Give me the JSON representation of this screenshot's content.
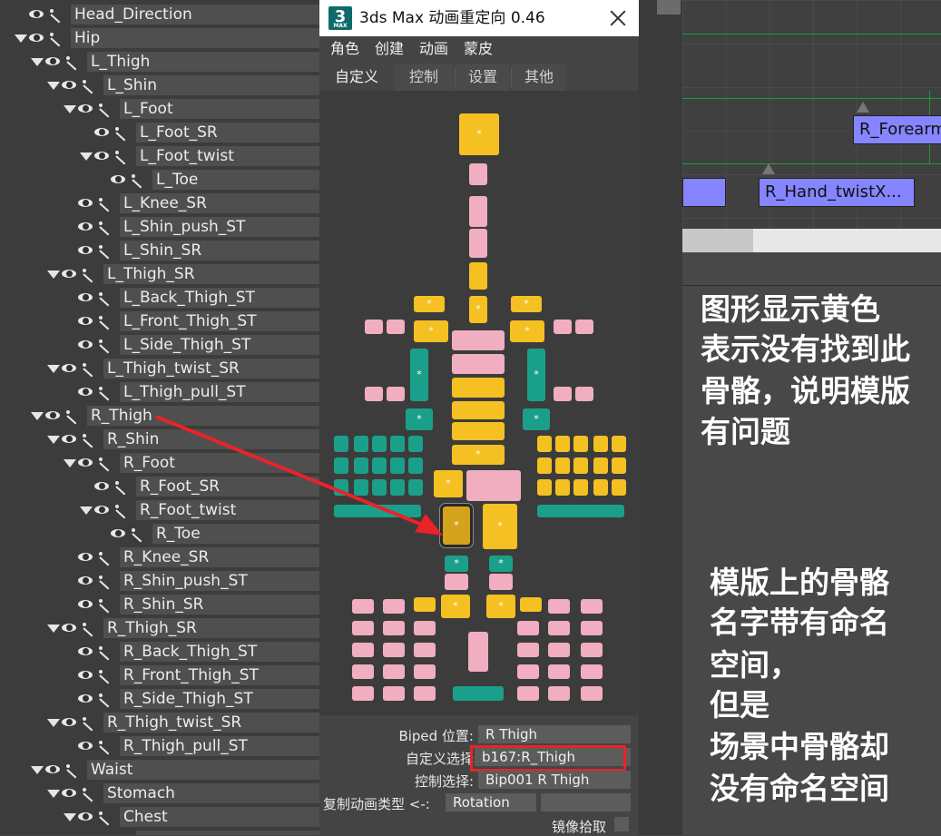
{
  "tree": {
    "rows": [
      {
        "label": "Head_Direction",
        "arrow": false
      },
      {
        "label": "Hip",
        "arrow": true
      },
      {
        "label": "L_Thigh",
        "arrow": true
      },
      {
        "label": "L_Shin",
        "arrow": true
      },
      {
        "label": "L_Foot",
        "arrow": true
      },
      {
        "label": "L_Foot_SR",
        "arrow": false
      },
      {
        "label": "L_Foot_twist",
        "arrow": true
      },
      {
        "label": "L_Toe",
        "arrow": false
      },
      {
        "label": "L_Knee_SR",
        "arrow": false
      },
      {
        "label": "L_Shin_push_ST",
        "arrow": false
      },
      {
        "label": "L_Shin_SR",
        "arrow": false
      },
      {
        "label": "L_Thigh_SR",
        "arrow": true
      },
      {
        "label": "L_Back_Thigh_ST",
        "arrow": false
      },
      {
        "label": "L_Front_Thigh_ST",
        "arrow": false
      },
      {
        "label": "L_Side_Thigh_ST",
        "arrow": false
      },
      {
        "label": "L_Thigh_twist_SR",
        "arrow": true
      },
      {
        "label": "L_Thigh_pull_ST",
        "arrow": false
      },
      {
        "label": "R_Thigh",
        "arrow": true
      },
      {
        "label": "R_Shin",
        "arrow": true
      },
      {
        "label": "R_Foot",
        "arrow": true
      },
      {
        "label": "R_Foot_SR",
        "arrow": false
      },
      {
        "label": "R_Foot_twist",
        "arrow": true
      },
      {
        "label": "R_Toe",
        "arrow": false
      },
      {
        "label": "R_Knee_SR",
        "arrow": false
      },
      {
        "label": "R_Shin_push_ST",
        "arrow": false
      },
      {
        "label": "R_Shin_SR",
        "arrow": false
      },
      {
        "label": "R_Thigh_SR",
        "arrow": true
      },
      {
        "label": "R_Back_Thigh_ST",
        "arrow": false
      },
      {
        "label": "R_Front_Thigh_ST",
        "arrow": false
      },
      {
        "label": "R_Side_Thigh_ST",
        "arrow": false
      },
      {
        "label": "R_Thigh_twist_SR",
        "arrow": true
      },
      {
        "label": "R_Thigh_pull_ST",
        "arrow": false
      },
      {
        "label": "Waist",
        "arrow": true
      },
      {
        "label": "Stomach",
        "arrow": true
      },
      {
        "label": "Chest",
        "arrow": true
      },
      {
        "label": "",
        "arrow": false
      }
    ]
  },
  "dialog": {
    "logo": "3",
    "logo_sub": "MAX",
    "title": "3ds Max 动画重定向 0.46",
    "menus": [
      "角色",
      "创建",
      "动画",
      "蒙皮"
    ],
    "tabs": [
      "自定义",
      "控制",
      "设置",
      "其他"
    ],
    "star": "*",
    "info": {
      "biped_label": "Biped 位置:",
      "biped_value": "R Thigh",
      "custom_label": "自定义选择",
      "custom_value": "b167:R_Thigh",
      "control_label": "控制选择:",
      "control_value": "Bip001 R Thigh",
      "copy_label": "复制动画类型 <-:",
      "copy_value": "Rotation",
      "copy_extra": "",
      "mirror_label": "镜像拾取"
    }
  },
  "graph": {
    "node_forearm": "R_Forearm",
    "node_hand": "R_Hand_twistX..."
  },
  "notes": {
    "top": [
      "图形显示黄色",
      "表示没有找到此",
      "骨骼，说明模版",
      "有问题"
    ],
    "bottom": [
      "模版上的骨骼",
      "名字带有命名",
      "空间，",
      "但是",
      "场景中骨骼却",
      "没有命名空间"
    ]
  },
  "colors": {
    "yellow": "#f5c022",
    "pink": "#f0aec0",
    "green": "#1aa08a",
    "annotation_red": "#e8232a",
    "node_blue": "#8585ff"
  }
}
